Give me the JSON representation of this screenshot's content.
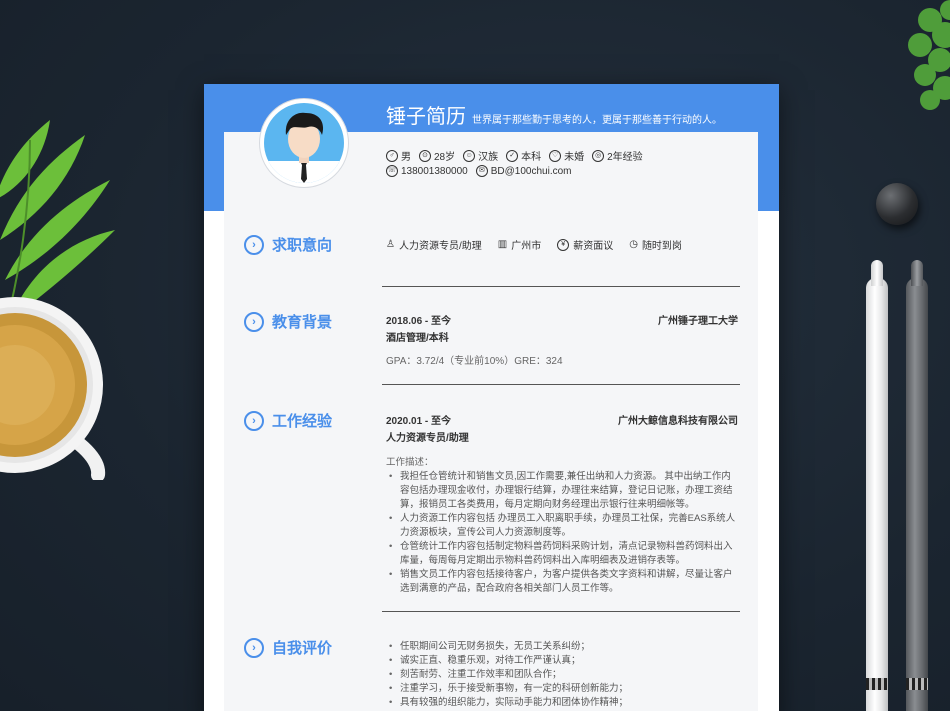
{
  "resume": {
    "name": "锤子简历",
    "motto": "世界属于那些勤于思考的人，更属于那些善于行动的人。",
    "info1": [
      {
        "icon": "gender-icon",
        "glyph": "♂",
        "text": "男"
      },
      {
        "icon": "age-icon",
        "glyph": "⊙",
        "text": "28岁"
      },
      {
        "icon": "ethnicity-icon",
        "glyph": "☺",
        "text": "汉族"
      },
      {
        "icon": "education-icon",
        "glyph": "✓",
        "text": "本科"
      },
      {
        "icon": "marital-icon",
        "glyph": "♡",
        "text": "未婚"
      },
      {
        "icon": "experience-icon",
        "glyph": "◎",
        "text": "2年经验"
      }
    ],
    "info2": [
      {
        "icon": "phone-icon",
        "glyph": "☏",
        "text": "138001380000"
      },
      {
        "icon": "email-icon",
        "glyph": "✉",
        "text": "BD@100chui.com"
      }
    ],
    "sections": {
      "intent": "求职意向",
      "education": "教育背景",
      "work": "工作经验",
      "self": "自我评价"
    },
    "intent": [
      {
        "icon": "position-icon",
        "glyph": "♙",
        "text": "人力资源专员/助理"
      },
      {
        "icon": "city-icon",
        "glyph": "▥",
        "text": "广州市"
      },
      {
        "icon": "salary-icon",
        "glyph": "¥",
        "text": "薪资面议"
      },
      {
        "icon": "arrival-icon",
        "glyph": "◷",
        "text": "随时到岗"
      }
    ],
    "education": {
      "date": "2018.06 - 至今",
      "school": "广州锤子理工大学",
      "major": "酒店管理/本科",
      "gpa": "GPA：3.72/4（专业前10%）GRE：324"
    },
    "work": {
      "date": "2020.01 - 至今",
      "company": "广州大鲸信息科技有限公司",
      "title": "人力资源专员/助理",
      "desc_label": "工作描述：",
      "bullets": [
        "我担任仓管统计和销售文员,因工作需要,兼任出纳和人力资源。 其中出纳工作内容包括办理现金收付，办理银行结算，办理往来结算，登记日记账，办理工资结算，报销员工各类费用，每月定期向财务经理出示银行往来明细帐等。",
        "人力资源工作内容包括 办理员工入职离职手续，办理员工社保，完善EAS系统人力资源板块，宣传公司人力资源制度等。",
        "仓管统计工作内容包括制定物料兽药饲料采购计划，清点记录物料兽药饲料出入库量，每周每月定期出示物料兽药饲料出入库明细表及进销存表等。",
        "销售文员工作内容包括接待客户，为客户提供各类文字资料和讲解，尽量让客户选到满意的产品，配合政府各相关部门人员工作等。"
      ]
    },
    "self": [
      "任职期间公司无财务损失，无员工关系纠纷；",
      "诚实正直、稳重乐观，对待工作严谨认真；",
      "刻苦耐劳、注重工作效率和团队合作；",
      "注重学习，乐于接受新事物，有一定的科研创新能力；",
      "具有较强的组织能力，实际动手能力和团体协作精神；"
    ]
  }
}
